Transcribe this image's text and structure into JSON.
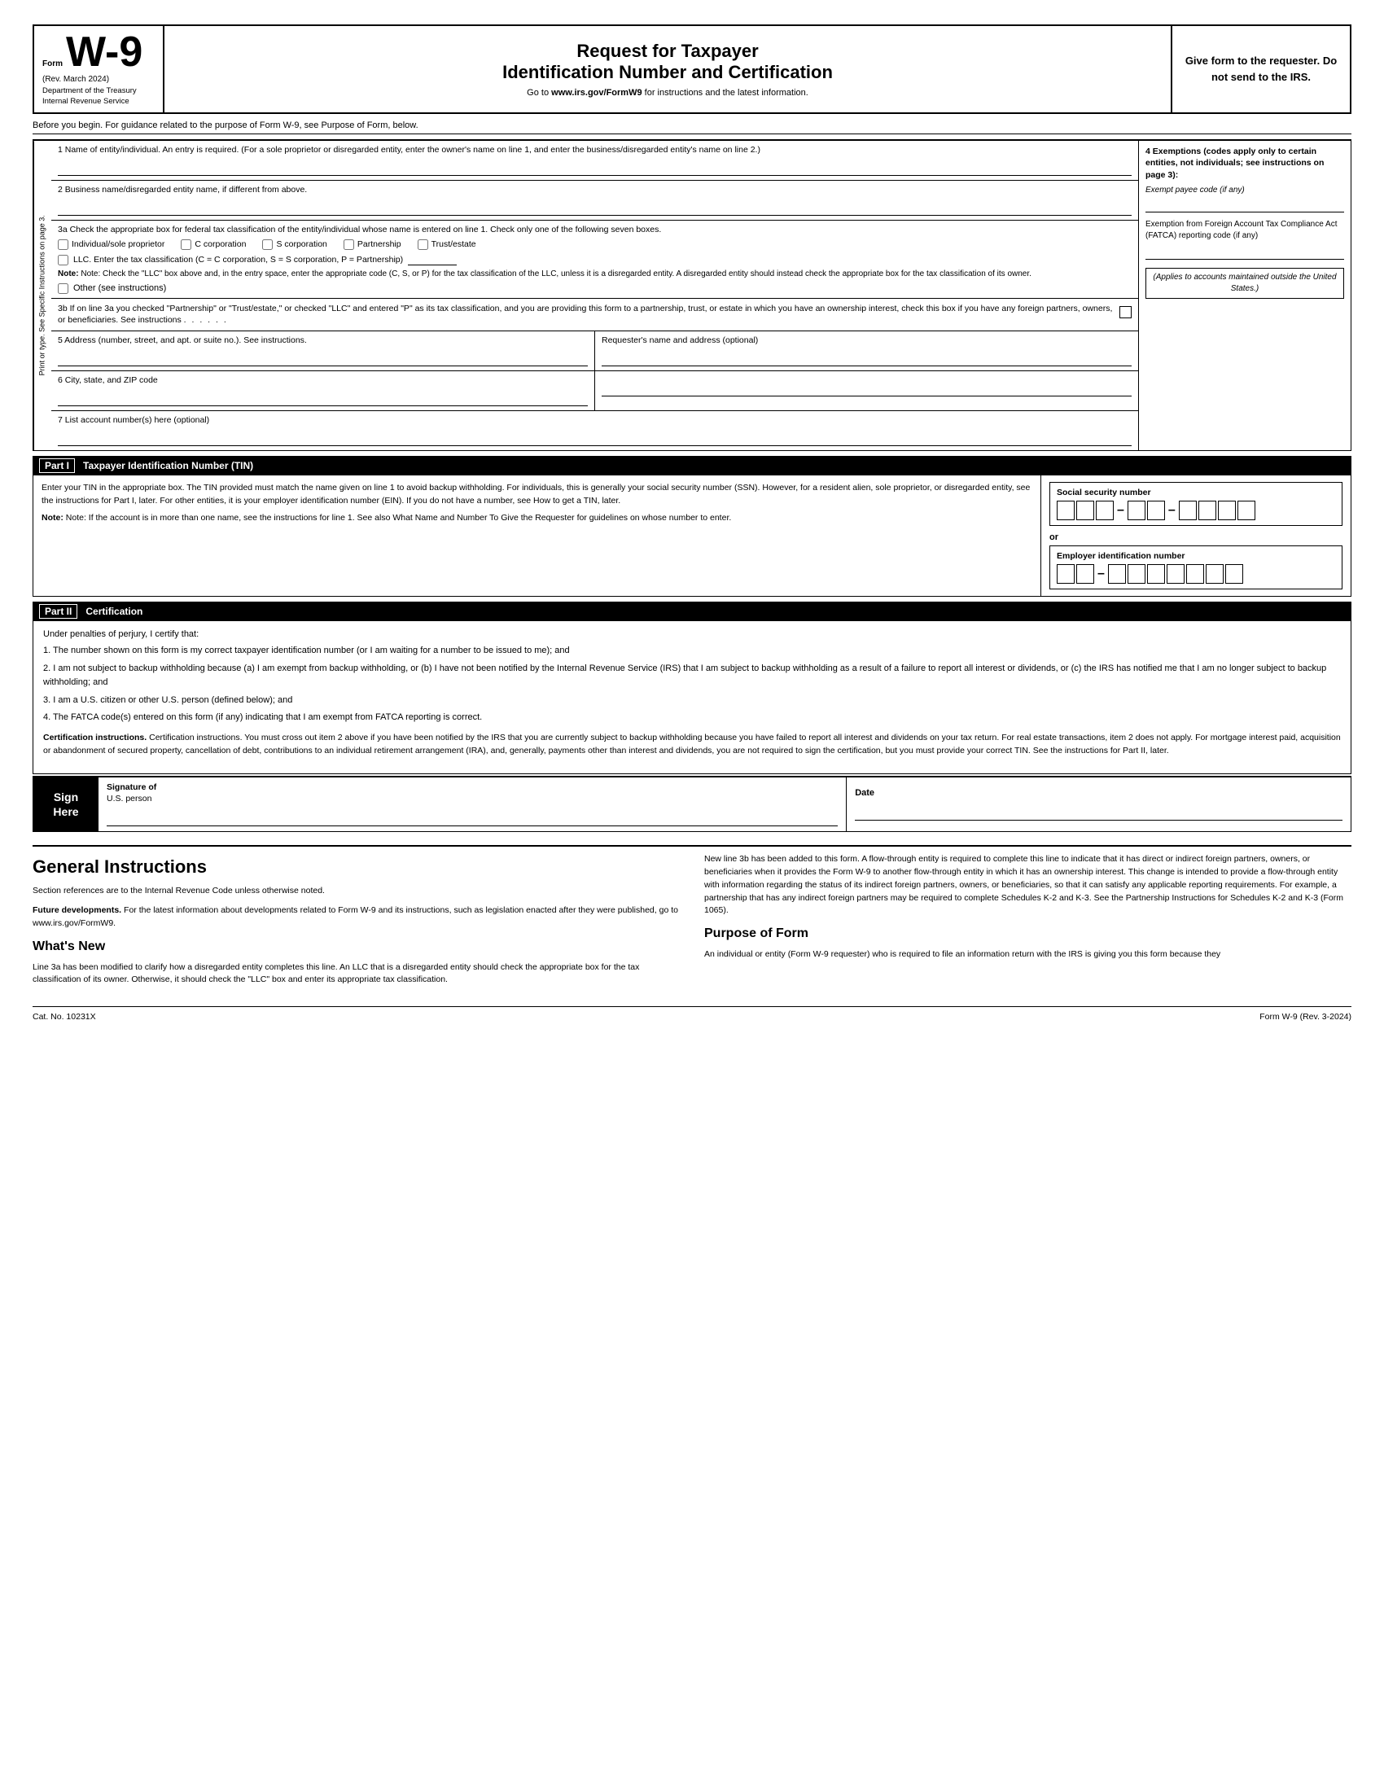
{
  "header": {
    "form_label": "Form",
    "form_number": "W-9",
    "rev_date": "(Rev. March 2024)",
    "dept_line1": "Department of the Treasury",
    "dept_line2": "Internal Revenue Service",
    "title_line1": "Request for Taxpayer",
    "title_line2": "Identification Number and Certification",
    "url_text": "Go to",
    "url_link": "www.irs.gov/FormW9",
    "url_suffix": "for instructions and the latest information.",
    "give_form_text": "Give form to the requester. Do not send to the IRS."
  },
  "before_begin": {
    "text": "Before you begin. For guidance related to the purpose of Form W-9, see Purpose of Form, below."
  },
  "side_label": {
    "text": "Print or type. See Specific Instructions on page 3."
  },
  "fields": {
    "line1_label": "1  Name of entity/individual. An entry is required. (For a sole proprietor or disregarded entity, enter the owner's name on line 1, and enter the business/disregarded entity's name on line 2.)",
    "line2_label": "2  Business name/disregarded entity name, if different from above.",
    "line3a_label": "3a Check the appropriate box for federal tax classification of the entity/individual whose name is entered on line 1. Check only one of the following seven boxes.",
    "checkbox_individual": "Individual/sole proprietor",
    "checkbox_c_corp": "C corporation",
    "checkbox_s_corp": "S corporation",
    "checkbox_partnership": "Partnership",
    "checkbox_trust": "Trust/estate",
    "llc_label": "LLC. Enter the tax classification (C = C corporation, S = S corporation, P = Partnership)",
    "llc_note": "Note: Check the \"LLC\" box above and, in the entry space, enter the appropriate code (C, S, or P) for the tax classification of the LLC, unless it is a disregarded entity. A disregarded entity should instead check the appropriate box for the tax classification of its owner.",
    "other_label": "Other (see instructions)",
    "line3b_text": "3b If on line 3a you checked \"Partnership\" or \"Trust/estate,\" or checked \"LLC\" and entered \"P\" as its tax classification, and you are providing this form to a partnership, trust, or estate in which you have an ownership interest, check this box if you have any foreign partners, owners, or beneficiaries. See instructions",
    "line5_label": "5  Address (number, street, and apt. or suite no.). See instructions.",
    "line5_right_label": "Requester's name and address (optional)",
    "line6_label": "6  City, state, and ZIP code",
    "line7_label": "7  List account number(s) here (optional)"
  },
  "exemptions": {
    "header": "4  Exemptions (codes apply only to certain entities, not individuals; see instructions on page 3):",
    "payee_label": "Exempt payee code (if any)",
    "fatca_label": "Exemption from Foreign Account Tax Compliance Act (FATCA) reporting code (if any)",
    "applies_note": "(Applies to accounts maintained outside the United States.)"
  },
  "part1": {
    "label": "Part I",
    "title": "Taxpayer Identification Number (TIN)",
    "tin_text1": "Enter your TIN in the appropriate box. The TIN provided must match the name given on line 1 to avoid backup withholding. For individuals, this is generally your social security number (SSN). However, for a resident alien, sole proprietor, or disregarded entity, see the instructions for Part I, later. For other entities, it is your employer identification number (EIN). If you do not have a number, see How to get a TIN, later.",
    "tin_note": "Note: If the account is in more than one name, see the instructions for line 1. See also What Name and Number To Give the Requester for guidelines on whose number to enter.",
    "ssn_label": "Social security number",
    "ssn_dash1": "–",
    "ssn_dash2": "–",
    "or_text": "or",
    "ein_label": "Employer identification number",
    "ein_dash": "–"
  },
  "part2": {
    "label": "Part II",
    "title": "Certification",
    "intro": "Under penalties of perjury, I certify that:",
    "item1": "1. The number shown on this form is my correct taxpayer identification number (or I am waiting for a number to be issued to me); and",
    "item2": "2. I am not subject to backup withholding because (a) I am exempt from backup withholding, or (b) I have not been notified by the Internal Revenue Service (IRS) that I am subject to backup withholding as a result of a failure to report all interest or dividends, or (c) the IRS has notified me that I am no longer subject to backup withholding; and",
    "item3": "3. I am a U.S. citizen or other U.S. person (defined below); and",
    "item4": "4. The FATCA code(s) entered on this form (if any) indicating that I am exempt from FATCA reporting is correct.",
    "cert_instructions": "Certification instructions. You must cross out item 2 above if you have been notified by the IRS that you are currently subject to backup withholding because you have failed to report all interest and dividends on your tax return. For real estate transactions, item 2 does not apply. For mortgage interest paid, acquisition or abandonment of secured property, cancellation of debt, contributions to an individual retirement arrangement (IRA), and, generally, payments other than interest and dividends, you are not required to sign the certification, but you must provide your correct TIN. See the instructions for Part II, later."
  },
  "sign_here": {
    "label_line1": "Sign",
    "label_line2": "Here",
    "signature_label": "Signature of",
    "signature_sub": "U.S. person",
    "date_label": "Date"
  },
  "general_instructions": {
    "title": "General Instructions",
    "intro_para": "Section references are to the Internal Revenue Code unless otherwise noted.",
    "future_dev_title": "Future developments.",
    "future_dev_text": "For the latest information about developments related to Form W-9 and its instructions, such as legislation enacted after they were published, go to www.irs.gov/FormW9.",
    "whats_new_title": "What's New",
    "whats_new_text": "Line 3a has been modified to clarify how a disregarded entity completes this line. An LLC that is a disregarded entity should check the appropriate box for the tax classification of its owner. Otherwise, it should check the \"LLC\" box and enter its appropriate tax classification.",
    "new_line3b_title": "New line 3b",
    "new_line3b_text": "New line 3b has been added to this form. A flow-through entity is required to complete this line to indicate that it has direct or indirect foreign partners, owners, or beneficiaries when it provides the Form W-9 to another flow-through entity in which it has an ownership interest. This change is intended to provide a flow-through entity with information regarding the status of its indirect foreign partners, owners, or beneficiaries, so that it can satisfy any applicable reporting requirements. For example, a partnership that has any indirect foreign partners may be required to complete Schedules K-2 and K-3. See the Partnership Instructions for Schedules K-2 and K-3 (Form 1065).",
    "purpose_title": "Purpose of Form",
    "purpose_text": "An individual or entity (Form W-9 requester) who is required to file an information return with the IRS is giving you this form because they"
  },
  "footer": {
    "cat_no": "Cat. No. 10231X",
    "form_label": "Form W-9 (Rev. 3-2024)"
  }
}
